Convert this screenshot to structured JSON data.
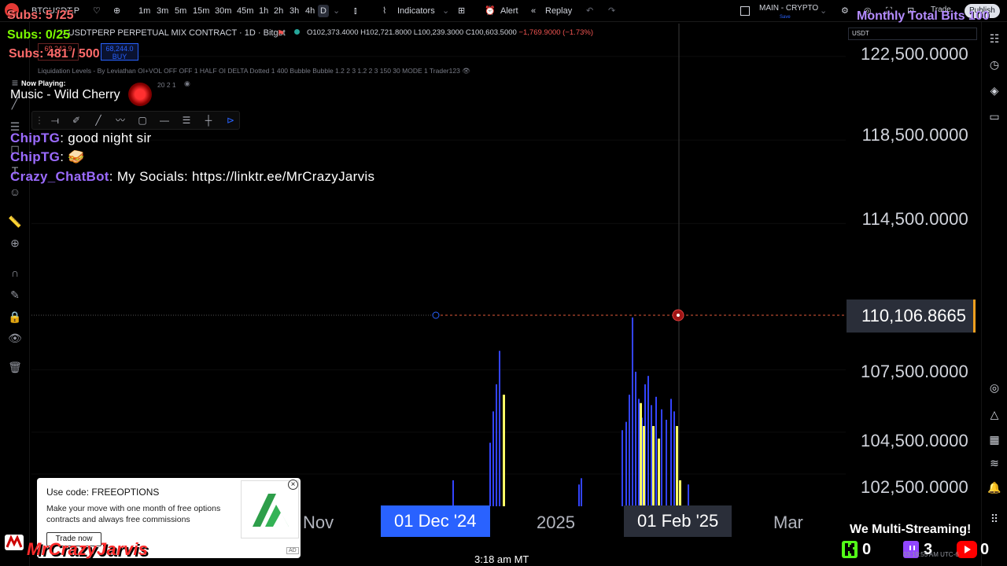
{
  "toolbar": {
    "symbol": "BTCUSDT.P",
    "intervals": [
      "1m",
      "3m",
      "5m",
      "15m",
      "30m",
      "45m",
      "1h",
      "2h",
      "3h",
      "4h",
      "D"
    ],
    "active_interval": "D",
    "indicators_label": "Indicators",
    "alert_label": "Alert",
    "replay_label": "Replay",
    "layout_name": "MAIN - CRYPTO",
    "layout_status": "Save",
    "trade_label": "Trade",
    "publish_label": "Publish"
  },
  "legend": {
    "title": "BTCUSDT PERPETUAL MIX CONTRACT · 1D · Bitget",
    "title_visible": "TCUSDTPERP PERPETUAL MIX CONTRACT · 1D · Bitget",
    "open": "O102,373.4000",
    "high": "H102,721.8000",
    "low": "L100,239.3000",
    "close": "C100,603.5000",
    "change": "−1,769.9000 (−1.73%)",
    "sell_price": "68,243.9",
    "buy_price": "68,244.0",
    "buy_label": "BUY",
    "indicator_line": "Liquidation Levels - By Leviathan OI+VOL OFF OFF 1 HALF OI DELTA Dotted 1 400 Bubble Bubble 1.2 2 3 1.2 2 3 150 30 MODE 1 Trader123",
    "indicator_line2": "20 2 1"
  },
  "price_axis": {
    "currency": "USDT",
    "labels": [
      "122,500.0000",
      "118,500.0000",
      "114,500.0000",
      "107,500.0000",
      "104,500.0000",
      "102,500.0000"
    ],
    "current_price": "110,106.8665"
  },
  "time_axis": {
    "labels": [
      "Nov",
      "01 Dec '24",
      "2025",
      "01 Feb '25",
      "Mar"
    ],
    "highlight_1": "01 Dec '24",
    "highlight_2": "01 Feb '25"
  },
  "overlay": {
    "subs_1": "Subs: 5 /25",
    "subs_2": "Subs: 0/25",
    "subs_3": "Subs: 481 / 500",
    "monthly_bits": "Monthly Total Bits 100",
    "now_playing_label": "Now Playing:",
    "now_playing_track": "Music - Wild Cherry",
    "chat": [
      {
        "user": "ChipTG",
        "message": "good night sir"
      },
      {
        "user": "ChipTG",
        "message": "🥪"
      },
      {
        "user": "Crazy_ChatBot",
        "message": "My Socials: https://linktr.ee/MrCrazyJarvis"
      }
    ],
    "brand": "MrCrazyJarvis",
    "clock": "3:18 am MT",
    "multistream": "We Multi-Streaming!",
    "kick_count": "0",
    "twitch_count": "3",
    "youtube_count": "0",
    "utc_text": "03:19:55 AM UTC-6"
  },
  "ad": {
    "title": "Use code: FREEOPTIONS",
    "body": "Make your move with one month of free options contracts and always free commissions",
    "button": "Trade now",
    "tag": "AD"
  },
  "chart_data": {
    "type": "bar",
    "symbol": "BTCUSDT.P",
    "interval": "1D",
    "y_range": [
      101500,
      124000
    ],
    "current_price": 110106.8665,
    "note_visible_bars": "liquidation level bars near Dec '24 and late Jan '25",
    "series": [
      {
        "name": "blue",
        "color": "#3344ff",
        "values": [
          [
            575,
            102200
          ],
          [
            622,
            104000
          ],
          [
            626,
            105500
          ],
          [
            630,
            106800
          ],
          [
            634,
            108400
          ],
          [
            735,
            102000
          ],
          [
            738,
            102300
          ],
          [
            790,
            104600
          ],
          [
            795,
            105000
          ],
          [
            799,
            106300
          ],
          [
            803,
            110000
          ],
          [
            807,
            107400
          ],
          [
            811,
            106100
          ],
          [
            815,
            105200
          ],
          [
            819,
            106800
          ],
          [
            823,
            107200
          ],
          [
            827,
            105800
          ],
          [
            833,
            106200
          ],
          [
            840,
            105600
          ],
          [
            846,
            105100
          ],
          [
            852,
            106100
          ],
          [
            856,
            105500
          ],
          [
            874,
            102000
          ]
        ]
      },
      {
        "name": "yellow",
        "color": "#ffff66",
        "values": [
          [
            639,
            106300
          ],
          [
            813,
            105900
          ],
          [
            817,
            104800
          ],
          [
            829,
            104800
          ],
          [
            836,
            104200
          ],
          [
            859,
            104800
          ],
          [
            863,
            102200
          ]
        ]
      }
    ]
  },
  "colors": {
    "accent_blue": "#2962ff",
    "down_red": "#ef5350",
    "brand_red": "#ff2a2a",
    "twitch_purple": "#9146ff",
    "kick_green": "#53fc18",
    "youtube_red": "#ff0000"
  }
}
